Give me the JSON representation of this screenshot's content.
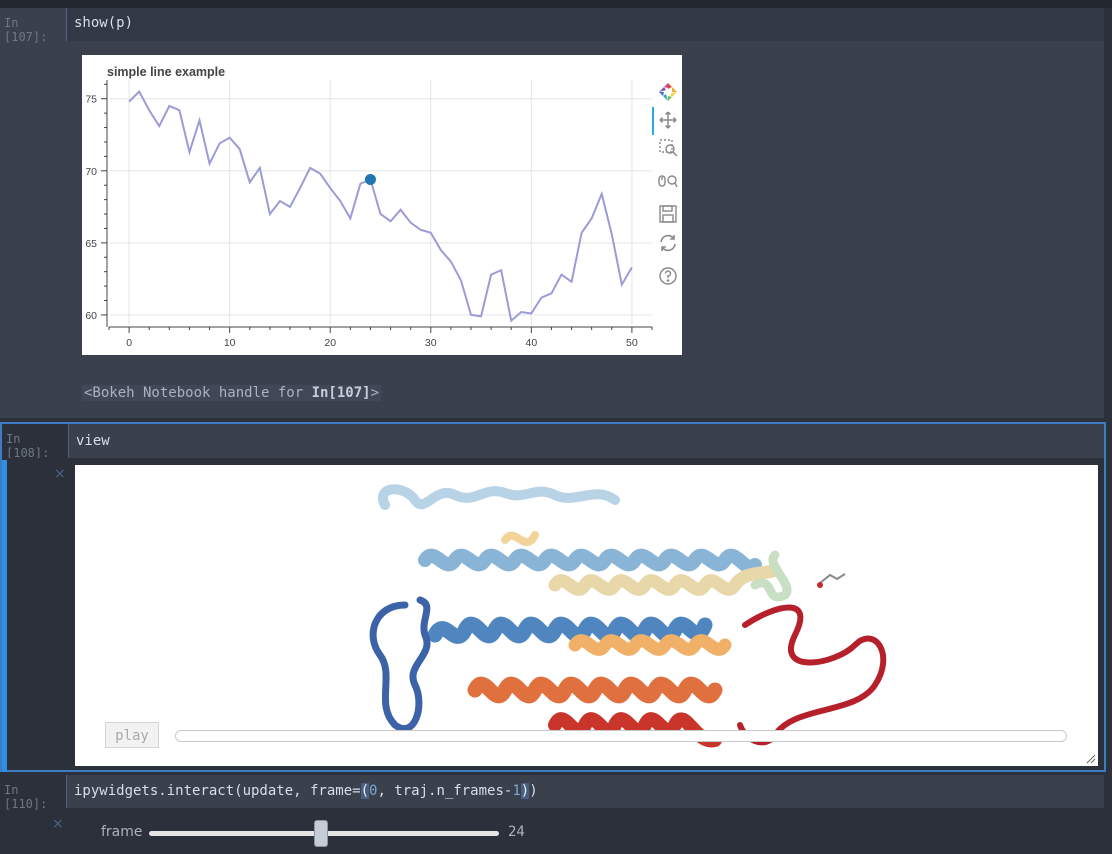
{
  "cells": {
    "c107": {
      "prompt": "In [107]:",
      "code": "show(p)",
      "output_text_prefix": "<Bokeh Notebook handle for ",
      "output_text_bold": "In[107]",
      "output_text_suffix": ">"
    },
    "c108": {
      "prompt": "In [108]:",
      "code": "view",
      "play_label": "play"
    },
    "c110": {
      "prompt": "In [110]:",
      "code_prefix": "ipywidgets.interact(update, frame=",
      "code_open": "(",
      "code_zero": "0",
      "code_mid": ", traj.n_frames-",
      "code_one": "1",
      "code_close": ")",
      "code_end": ")",
      "slider_label": "frame",
      "slider_value": "24",
      "slider_fraction": 0.49
    }
  },
  "close_glyph": "×",
  "toolbar_icons": [
    "bokeh-logo-icon",
    "pan-icon",
    "box-zoom-icon",
    "wheel-zoom-icon",
    "save-icon",
    "reset-icon",
    "help-icon"
  ],
  "chart_data": {
    "type": "line",
    "title": "simple line example",
    "xlabel": "",
    "ylabel": "",
    "xlim": [
      -2,
      52
    ],
    "ylim": [
      59.3,
      76.3
    ],
    "x_ticks": [
      0,
      10,
      20,
      30,
      40,
      50
    ],
    "y_ticks": [
      60,
      65,
      70,
      75
    ],
    "grid": true,
    "line_color": "#9b9bd6",
    "marker_color": "#1f77b4",
    "series": [
      {
        "x": [
          0,
          1,
          2,
          3,
          4,
          5,
          6,
          7,
          8,
          9,
          10,
          11,
          12,
          13,
          14,
          15,
          16,
          17,
          18,
          19,
          20,
          21,
          22,
          23,
          24,
          25,
          26,
          27,
          28,
          29,
          30,
          31,
          32,
          33,
          34,
          35,
          36,
          37,
          38,
          39,
          40,
          41,
          42,
          43,
          44,
          45,
          46,
          47,
          48,
          49,
          50
        ],
        "values": [
          74.8,
          75.5,
          74.2,
          73.1,
          74.5,
          74.2,
          71.3,
          73.5,
          70.5,
          71.9,
          72.3,
          71.5,
          69.2,
          70.2,
          67.0,
          67.9,
          67.5,
          68.8,
          70.2,
          69.8,
          68.8,
          67.9,
          66.7,
          69.1,
          69.4,
          67.0,
          66.5,
          67.3,
          66.4,
          65.9,
          65.7,
          64.5,
          63.7,
          62.4,
          60.0,
          59.9,
          62.8,
          63.1,
          59.6,
          60.2,
          60.1,
          61.2,
          61.5,
          62.8,
          62.3,
          65.7,
          66.7,
          68.4,
          65.6,
          62.1,
          63.3
        ]
      }
    ],
    "highlight_point": {
      "x": 24,
      "y": 69.4
    }
  }
}
